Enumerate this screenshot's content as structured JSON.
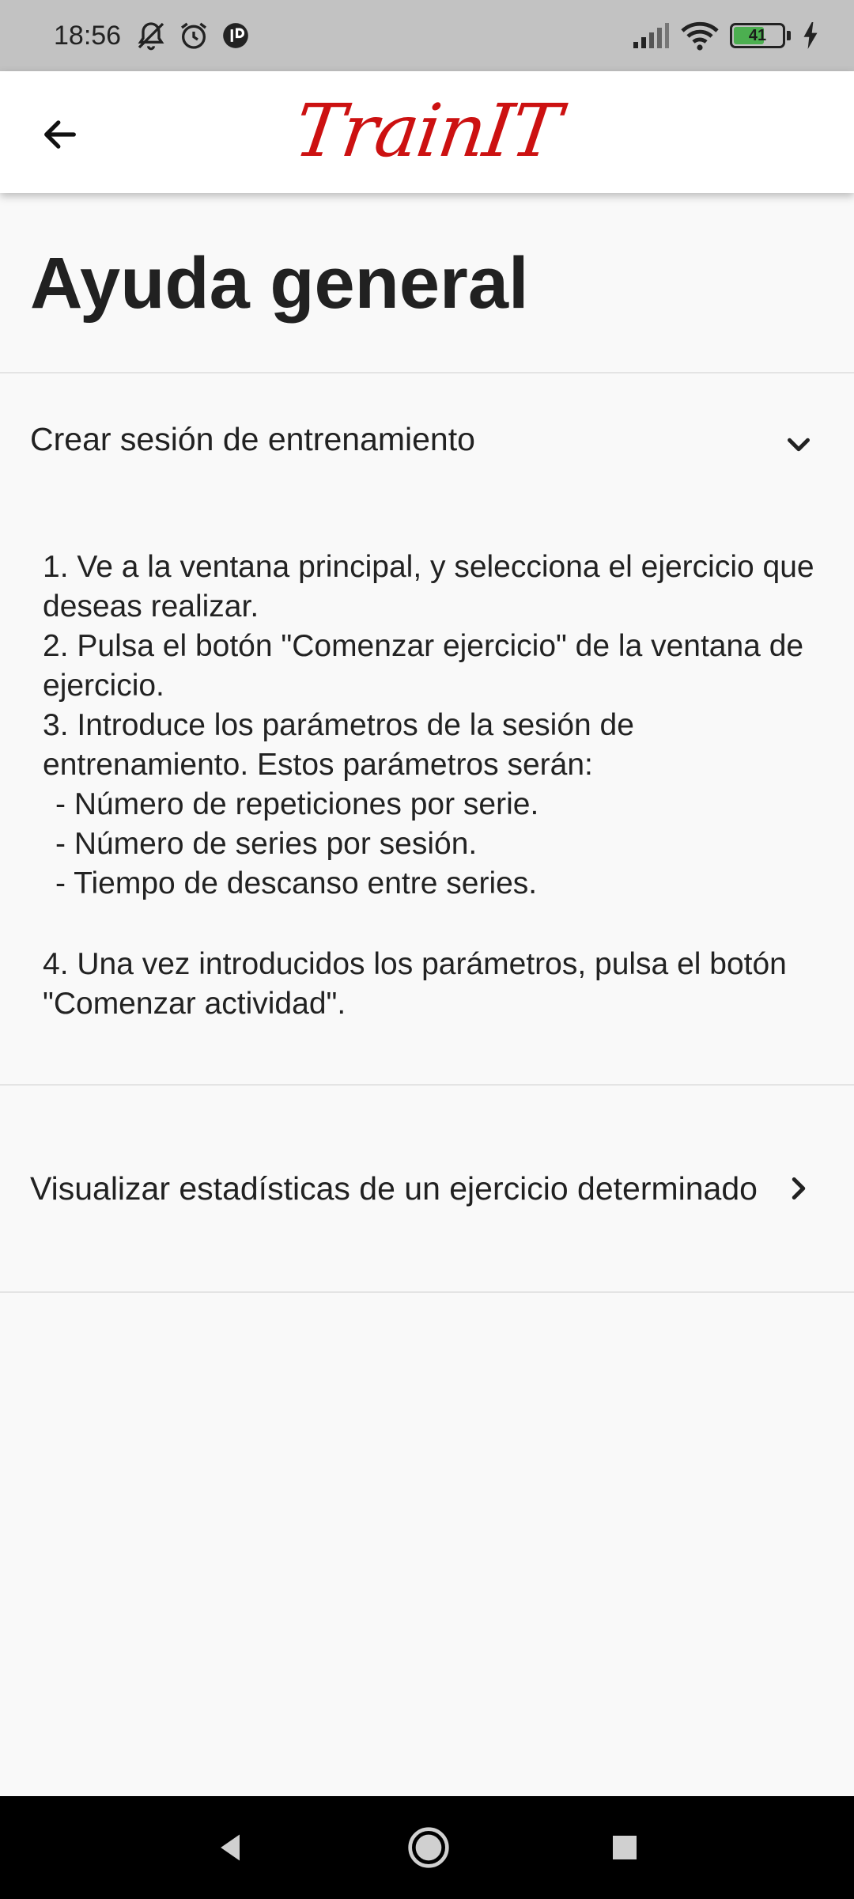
{
  "status_bar": {
    "time": "18:56",
    "battery_level": "41",
    "icons": [
      "muted-bell-icon",
      "alarm-icon",
      "app-notification-icon",
      "signal-icon",
      "wifi-icon",
      "battery-icon",
      "charging-icon"
    ]
  },
  "app_bar": {
    "back_icon": "arrow-left-icon",
    "logo_text": "TrainIT",
    "logo_color": "#cc1111"
  },
  "page": {
    "title": "Ayuda general"
  },
  "sections": [
    {
      "title": "Crear sesión de entrenamiento",
      "expanded": true,
      "icon": "chevron-down-icon",
      "steps": [
        "1. Ve a la ventana principal, y selecciona el ejercicio que deseas realizar.",
        "2. Pulsa el botón \"Comenzar ejercicio\" de la ventana de ejercicio.",
        "3. Introduce los parámetros de la sesión de entrenamiento. Estos parámetros serán:"
      ],
      "bullets": [
        "- Número de repeticiones por serie.",
        "- Número de series por sesión.",
        "- Tiempo de descanso entre series."
      ],
      "final_step": "4. Una vez introducidos los parámetros, pulsa el botón \"Comenzar actividad\"."
    },
    {
      "title": "Visualizar estadísticas de un ejercicio determinado",
      "expanded": false,
      "icon": "chevron-right-icon"
    }
  ],
  "nav_bar": {
    "icons": [
      "back-triangle-icon",
      "home-circle-icon",
      "recents-square-icon"
    ]
  }
}
